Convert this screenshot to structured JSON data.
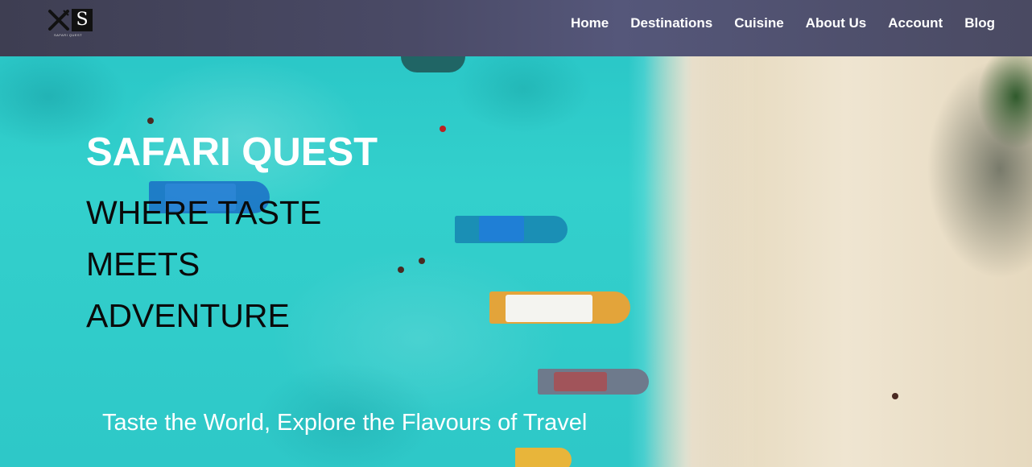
{
  "brand": {
    "logo_letter": "S",
    "logo_tagline": "SAFARI QUEST"
  },
  "nav": {
    "items": [
      {
        "label": "Home"
      },
      {
        "label": "Destinations"
      },
      {
        "label": "Cuisine"
      },
      {
        "label": "About Us"
      },
      {
        "label": "Account"
      },
      {
        "label": "Blog"
      }
    ]
  },
  "hero": {
    "title": "SAFARI QUEST",
    "tagline": "WHERE TASTE MEETS ADVENTURE",
    "subtitle": "Taste the World, Explore the Flavours of Travel",
    "image_icon": "aerial-beach-boats-image"
  },
  "colors": {
    "navbar": "#4a4a66",
    "nav_text": "#ffffff",
    "title_text": "#ffffff",
    "tagline_text": "#0a0a0a",
    "sea": "#2ec8c8",
    "sand": "#e8dcc2"
  }
}
